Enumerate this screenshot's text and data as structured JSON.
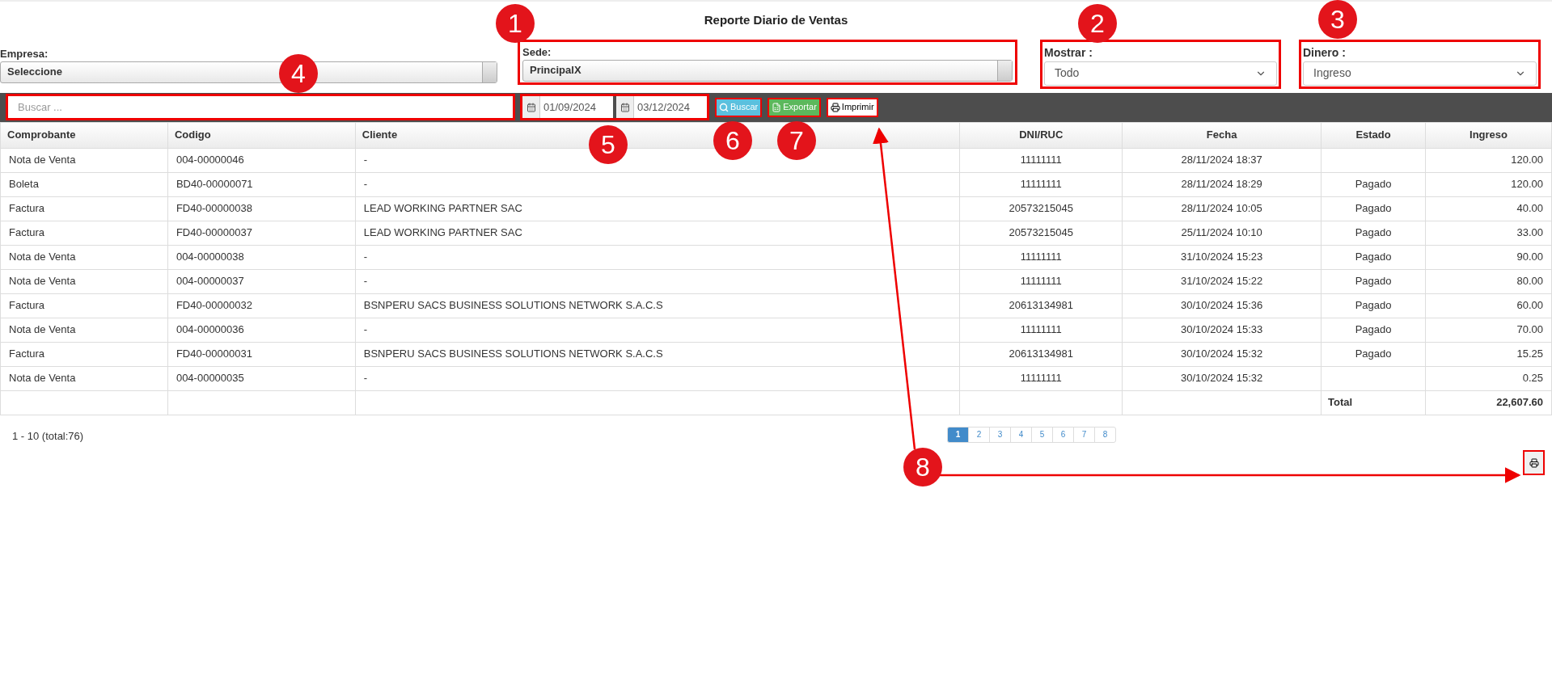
{
  "title": "Reporte Diario de Ventas",
  "filters": {
    "empresa": {
      "label": "Empresa:",
      "value": "Seleccione"
    },
    "sede": {
      "label": "Sede:",
      "value": "PrincipalX"
    },
    "mostrar": {
      "label": "Mostrar :",
      "value": "Todo"
    },
    "dinero": {
      "label": "Dinero :",
      "value": "Ingreso"
    }
  },
  "toolbar": {
    "search": {
      "placeholder": "Buscar ..."
    },
    "date_from": "01/09/2024",
    "date_to": "03/12/2024",
    "buttons": [
      {
        "label": "Buscar",
        "kind": "search"
      },
      {
        "label": "Exportar",
        "kind": "export"
      },
      {
        "label": "Imprimir",
        "kind": "print"
      }
    ]
  },
  "table": {
    "columns": [
      "Comprobante",
      "Codigo",
      "Cliente",
      "DNI/RUC",
      "Fecha",
      "Estado",
      "Ingreso"
    ],
    "rows": [
      [
        "Nota de Venta",
        "004-00000046",
        "-",
        "11111111",
        "28/11/2024 18:37",
        "",
        "120.00"
      ],
      [
        "Boleta",
        "BD40-00000071",
        "-",
        "11111111",
        "28/11/2024 18:29",
        "Pagado",
        "120.00"
      ],
      [
        "Factura",
        "FD40-00000038",
        "LEAD WORKING PARTNER SAC",
        "20573215045",
        "28/11/2024 10:05",
        "Pagado",
        "40.00"
      ],
      [
        "Factura",
        "FD40-00000037",
        "LEAD WORKING PARTNER SAC",
        "20573215045",
        "25/11/2024 10:10",
        "Pagado",
        "33.00"
      ],
      [
        "Nota de Venta",
        "004-00000038",
        "-",
        "11111111",
        "31/10/2024 15:23",
        "Pagado",
        "90.00"
      ],
      [
        "Nota de Venta",
        "004-00000037",
        "-",
        "11111111",
        "31/10/2024 15:22",
        "Pagado",
        "80.00"
      ],
      [
        "Factura",
        "FD40-00000032",
        "BSNPERU SACS BUSINESS SOLUTIONS NETWORK S.A.C.S",
        "20613134981",
        "30/10/2024 15:36",
        "Pagado",
        "60.00"
      ],
      [
        "Nota de Venta",
        "004-00000036",
        "-",
        "11111111",
        "30/10/2024 15:33",
        "Pagado",
        "70.00"
      ],
      [
        "Factura",
        "FD40-00000031",
        "BSNPERU SACS BUSINESS SOLUTIONS NETWORK S.A.C.S",
        "20613134981",
        "30/10/2024 15:32",
        "Pagado",
        "15.25"
      ],
      [
        "Nota de Venta",
        "004-00000035",
        "-",
        "11111111",
        "30/10/2024 15:32",
        "",
        "0.25"
      ]
    ],
    "total": {
      "label": "Total",
      "value": "22,607.60"
    }
  },
  "footer": {
    "range": "1 - 10 (total:76)",
    "pages": [
      {
        "label": "1",
        "selected": true
      },
      {
        "label": "2",
        "selected": false
      },
      {
        "label": "3",
        "selected": false
      },
      {
        "label": "4",
        "selected": false
      },
      {
        "label": "5",
        "selected": false
      },
      {
        "label": "6",
        "selected": false
      },
      {
        "label": "7",
        "selected": false
      },
      {
        "label": "8",
        "selected": false
      }
    ]
  },
  "annotations": [
    "1",
    "2",
    "3",
    "4",
    "5",
    "6",
    "7",
    "8"
  ]
}
